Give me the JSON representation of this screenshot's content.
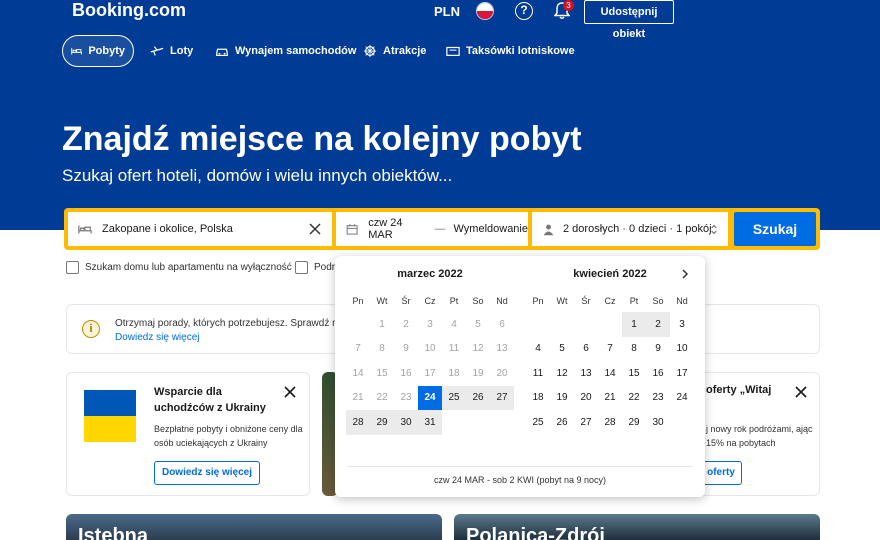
{
  "header": {
    "logo": "Booking.com",
    "currency": "PLN",
    "help": "?",
    "notif_count": "3",
    "share_btn": "Udostępnij obiekt"
  },
  "nav": [
    {
      "label": "Pobyty",
      "icon": "bed-icon"
    },
    {
      "label": "Loty",
      "icon": "plane-icon"
    },
    {
      "label": "Wynajem samochodów",
      "icon": "car-icon"
    },
    {
      "label": "Atrakcje",
      "icon": "attractions-icon"
    },
    {
      "label": "Taksówki lotniskowe",
      "icon": "taxi-icon"
    }
  ],
  "hero": {
    "title": "Znajdź miejsce na kolejny pobyt",
    "subtitle": "Szukaj ofert hoteli, domów i wielu innych obiektów..."
  },
  "search": {
    "destination": "Zakopane i okolice, Polska",
    "checkin": "czw 24 MAR",
    "dash": "—",
    "checkout": "Wymeldowanie",
    "guests": "2 dorosłych · 0 dzieci · 1 pokój",
    "submit": "Szukaj"
  },
  "checkboxes": {
    "apartment": "Szukam domu lub apartamentu na wyłączność",
    "second": "Podró"
  },
  "info": {
    "text": "Otrzymaj porady, których potrzebujesz. Sprawdź naj",
    "link": "Dowiedz się więcej"
  },
  "card1": {
    "title": "Wsparcie dla uchodźców z Ukrainy",
    "desc": "Bezpłatne pobyty i obniżone ceny dla osób uciekających z Ukrainy",
    "button": "Dowiedz się więcej"
  },
  "card2": {
    "title": "oferty „Witaj",
    "desc": "j nowy rok podróżami, ając 15% na pobytach",
    "button": "oferty"
  },
  "photos": [
    {
      "label": "Istebna"
    },
    {
      "label": "Polanica-Zdrój"
    }
  ],
  "datepicker": {
    "weekdays": [
      "Pn",
      "Wt",
      "Śr",
      "Cz",
      "Pt",
      "So",
      "Nd"
    ],
    "months": [
      {
        "title": "marzec 2022",
        "offset": 1,
        "days": 31,
        "past_until": 23,
        "selected": 24,
        "range_to": 31
      },
      {
        "title": "kwiecień 2022",
        "offset": 4,
        "days": 30,
        "past_until": 0,
        "selected": 0,
        "range_to": 2
      }
    ],
    "summary": "czw 24 MAR - sob 2 KWI (pobyt na 9 nocy)"
  },
  "colors": {
    "brand_blue": "#003b95",
    "accent_blue": "#006ce4",
    "search_yellow": "#febb02"
  }
}
